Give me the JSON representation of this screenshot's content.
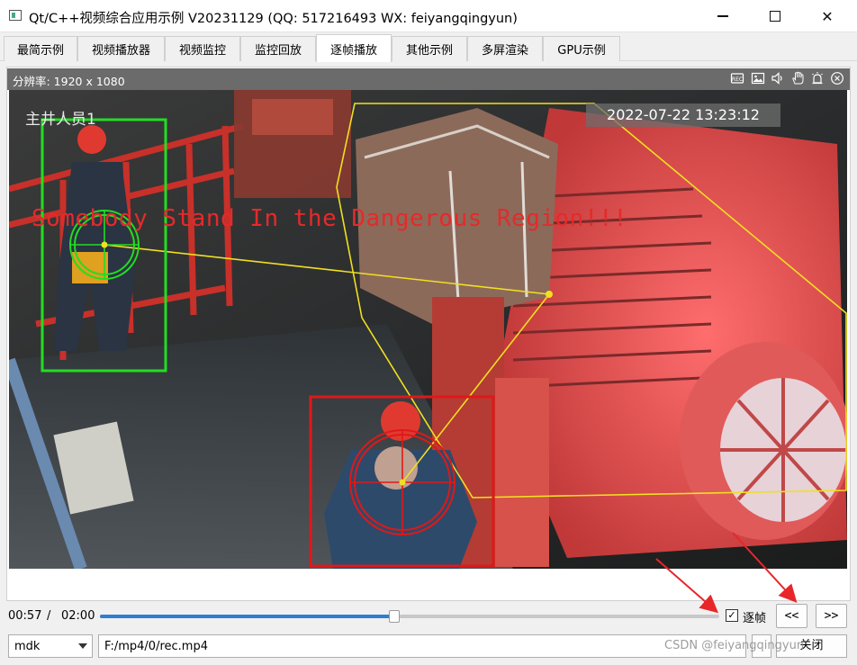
{
  "window": {
    "title": "Qt/C++视频综合应用示例 V20231129 (QQ: 517216493 WX: feiyangqingyun)",
    "minimize_glyph": "",
    "close_glyph": "✕"
  },
  "tabs": [
    {
      "label": "最简示例",
      "active": false
    },
    {
      "label": "视频播放器",
      "active": false
    },
    {
      "label": "视频监控",
      "active": false
    },
    {
      "label": "监控回放",
      "active": false
    },
    {
      "label": "逐帧播放",
      "active": true
    },
    {
      "label": "其他示例",
      "active": false
    },
    {
      "label": "多屏渲染",
      "active": false
    },
    {
      "label": "GPU示例",
      "active": false
    }
  ],
  "video": {
    "resolution": "分辨率: 1920 x 1080",
    "osd_name": "主井人员1",
    "osd_time": "2022-07-22 13:23:12",
    "osd_warning": "Somebody Stand In the Dangerous Region!!!",
    "header_icons": [
      "record-icon",
      "snapshot-icon",
      "sound-icon",
      "hand-icon",
      "alarm-icon",
      "close-circle-icon"
    ]
  },
  "controls": {
    "time_current": "00:57",
    "time_separator": "/",
    "time_total": "02:00",
    "progress_fraction": 0.475,
    "frame_checkbox_checked": true,
    "frame_checkbox_mark": "✓",
    "frame_checkbox_label": "逐帧",
    "prev_label": "<<",
    "next_label": ">>",
    "decoder": "mdk",
    "file_path": "F:/mp4/0/rec.mp4",
    "close_label": "关闭"
  },
  "watermark": "CSDN @feiyangqingyun",
  "colors": {
    "accent": "#2f7fd0",
    "detection_green": "#22dd22",
    "detection_red": "#e01818",
    "region_yellow": "#f0e020",
    "annotation_arrow": "#e8262a"
  }
}
